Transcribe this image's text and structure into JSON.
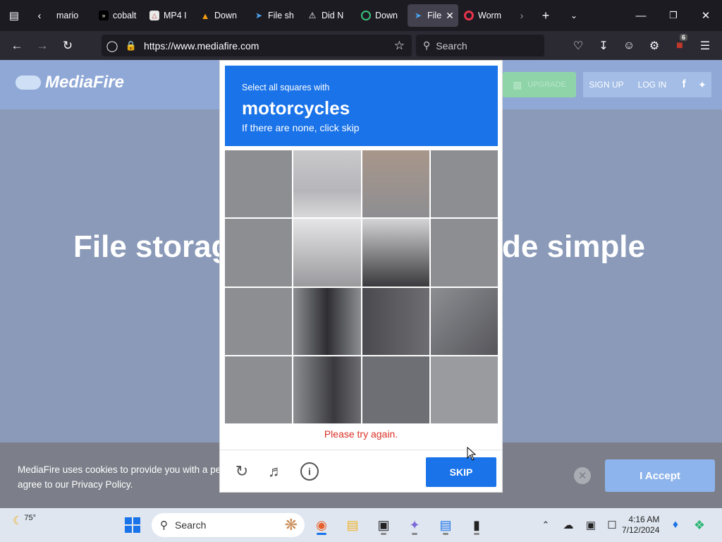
{
  "browser": {
    "tabs": [
      {
        "label": "mario",
        "favicon": "mario-favicon",
        "active": false
      },
      {
        "label": "cobalt",
        "favicon": ">>",
        "active": false
      },
      {
        "label": "MP4 I",
        "favicon": "mp4-favicon",
        "active": false
      },
      {
        "label": "Down",
        "favicon": "vlc-favicon",
        "active": false
      },
      {
        "label": "File sh",
        "favicon": "mediafire-favicon",
        "active": false
      },
      {
        "label": "Did N",
        "favicon": "warning-favicon",
        "active": false
      },
      {
        "label": "Down",
        "favicon": "download-favicon",
        "active": false
      },
      {
        "label": "File",
        "favicon": "mediafire-favicon",
        "active": true
      },
      {
        "label": "Worm",
        "favicon": "opera-favicon",
        "active": false
      }
    ],
    "url": "https://www.mediafire.com",
    "search_placeholder": "Search",
    "extension_badge": "6"
  },
  "site": {
    "logo_text": "MediaFire",
    "upgrade_label": "UPGRADE",
    "signup_label": "SIGN UP",
    "login_label": "LOG IN",
    "hero_left": "File storag",
    "hero_right": "de simple"
  },
  "cookie": {
    "text": "MediaFire uses cookies to provide you with a pe agree to our Privacy Policy.",
    "line1": "MediaFire uses cookies to provide you with a pe",
    "line2": "agree to our Privacy Policy.",
    "accept_label": "I Accept"
  },
  "captcha": {
    "instruction": "Select all squares with",
    "target": "motorcycles",
    "hint": "If there are none, click skip",
    "error": "Please try again.",
    "skip_label": "SKIP",
    "grid_size": 4,
    "header_color": "#1a73e8",
    "error_color": "#d93025"
  },
  "taskbar": {
    "weather": "75°",
    "search_placeholder": "Search",
    "time": "4:16 AM",
    "date": "7/12/2024"
  }
}
